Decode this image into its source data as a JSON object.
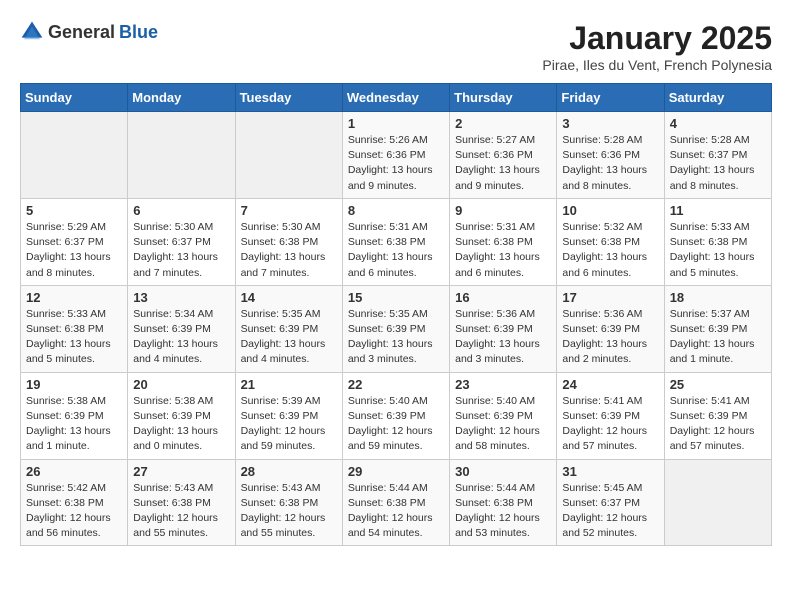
{
  "header": {
    "logo_general": "General",
    "logo_blue": "Blue",
    "title": "January 2025",
    "subtitle": "Pirae, Iles du Vent, French Polynesia"
  },
  "weekdays": [
    "Sunday",
    "Monday",
    "Tuesday",
    "Wednesday",
    "Thursday",
    "Friday",
    "Saturday"
  ],
  "weeks": [
    [
      {
        "day": "",
        "empty": true
      },
      {
        "day": "",
        "empty": true
      },
      {
        "day": "",
        "empty": true
      },
      {
        "day": "1",
        "sunrise": "5:26 AM",
        "sunset": "6:36 PM",
        "daylight": "13 hours and 9 minutes."
      },
      {
        "day": "2",
        "sunrise": "5:27 AM",
        "sunset": "6:36 PM",
        "daylight": "13 hours and 9 minutes."
      },
      {
        "day": "3",
        "sunrise": "5:28 AM",
        "sunset": "6:36 PM",
        "daylight": "13 hours and 8 minutes."
      },
      {
        "day": "4",
        "sunrise": "5:28 AM",
        "sunset": "6:37 PM",
        "daylight": "13 hours and 8 minutes."
      }
    ],
    [
      {
        "day": "5",
        "sunrise": "5:29 AM",
        "sunset": "6:37 PM",
        "daylight": "13 hours and 8 minutes."
      },
      {
        "day": "6",
        "sunrise": "5:30 AM",
        "sunset": "6:37 PM",
        "daylight": "13 hours and 7 minutes."
      },
      {
        "day": "7",
        "sunrise": "5:30 AM",
        "sunset": "6:38 PM",
        "daylight": "13 hours and 7 minutes."
      },
      {
        "day": "8",
        "sunrise": "5:31 AM",
        "sunset": "6:38 PM",
        "daylight": "13 hours and 6 minutes."
      },
      {
        "day": "9",
        "sunrise": "5:31 AM",
        "sunset": "6:38 PM",
        "daylight": "13 hours and 6 minutes."
      },
      {
        "day": "10",
        "sunrise": "5:32 AM",
        "sunset": "6:38 PM",
        "daylight": "13 hours and 6 minutes."
      },
      {
        "day": "11",
        "sunrise": "5:33 AM",
        "sunset": "6:38 PM",
        "daylight": "13 hours and 5 minutes."
      }
    ],
    [
      {
        "day": "12",
        "sunrise": "5:33 AM",
        "sunset": "6:38 PM",
        "daylight": "13 hours and 5 minutes."
      },
      {
        "day": "13",
        "sunrise": "5:34 AM",
        "sunset": "6:39 PM",
        "daylight": "13 hours and 4 minutes."
      },
      {
        "day": "14",
        "sunrise": "5:35 AM",
        "sunset": "6:39 PM",
        "daylight": "13 hours and 4 minutes."
      },
      {
        "day": "15",
        "sunrise": "5:35 AM",
        "sunset": "6:39 PM",
        "daylight": "13 hours and 3 minutes."
      },
      {
        "day": "16",
        "sunrise": "5:36 AM",
        "sunset": "6:39 PM",
        "daylight": "13 hours and 3 minutes."
      },
      {
        "day": "17",
        "sunrise": "5:36 AM",
        "sunset": "6:39 PM",
        "daylight": "13 hours and 2 minutes."
      },
      {
        "day": "18",
        "sunrise": "5:37 AM",
        "sunset": "6:39 PM",
        "daylight": "13 hours and 1 minute."
      }
    ],
    [
      {
        "day": "19",
        "sunrise": "5:38 AM",
        "sunset": "6:39 PM",
        "daylight": "13 hours and 1 minute."
      },
      {
        "day": "20",
        "sunrise": "5:38 AM",
        "sunset": "6:39 PM",
        "daylight": "13 hours and 0 minutes."
      },
      {
        "day": "21",
        "sunrise": "5:39 AM",
        "sunset": "6:39 PM",
        "daylight": "12 hours and 59 minutes."
      },
      {
        "day": "22",
        "sunrise": "5:40 AM",
        "sunset": "6:39 PM",
        "daylight": "12 hours and 59 minutes."
      },
      {
        "day": "23",
        "sunrise": "5:40 AM",
        "sunset": "6:39 PM",
        "daylight": "12 hours and 58 minutes."
      },
      {
        "day": "24",
        "sunrise": "5:41 AM",
        "sunset": "6:39 PM",
        "daylight": "12 hours and 57 minutes."
      },
      {
        "day": "25",
        "sunrise": "5:41 AM",
        "sunset": "6:39 PM",
        "daylight": "12 hours and 57 minutes."
      }
    ],
    [
      {
        "day": "26",
        "sunrise": "5:42 AM",
        "sunset": "6:38 PM",
        "daylight": "12 hours and 56 minutes."
      },
      {
        "day": "27",
        "sunrise": "5:43 AM",
        "sunset": "6:38 PM",
        "daylight": "12 hours and 55 minutes."
      },
      {
        "day": "28",
        "sunrise": "5:43 AM",
        "sunset": "6:38 PM",
        "daylight": "12 hours and 55 minutes."
      },
      {
        "day": "29",
        "sunrise": "5:44 AM",
        "sunset": "6:38 PM",
        "daylight": "12 hours and 54 minutes."
      },
      {
        "day": "30",
        "sunrise": "5:44 AM",
        "sunset": "6:38 PM",
        "daylight": "12 hours and 53 minutes."
      },
      {
        "day": "31",
        "sunrise": "5:45 AM",
        "sunset": "6:37 PM",
        "daylight": "12 hours and 52 minutes."
      },
      {
        "day": "",
        "empty": true
      }
    ]
  ]
}
